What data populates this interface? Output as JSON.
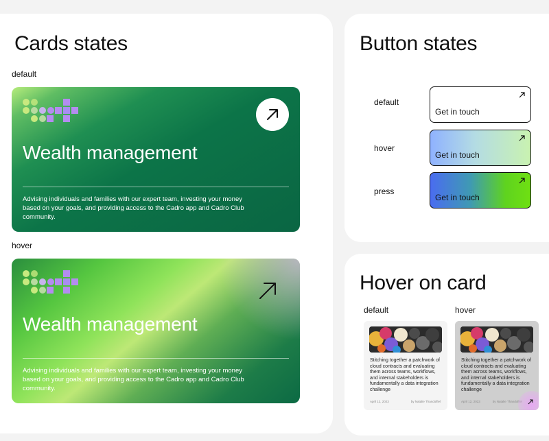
{
  "cards_panel": {
    "title": "Cards states",
    "default_label": "default",
    "hover_label": "hover",
    "card": {
      "title": "Wealth management",
      "description": "Advising individuals and families with our expert team, investing your money based on your goals, and providing access to the Cadro app and Cadro Club community."
    }
  },
  "button_panel": {
    "title": "Button states",
    "states": [
      {
        "label": "default",
        "button_text": "Get in touch"
      },
      {
        "label": "hover",
        "button_text": "Get in touch"
      },
      {
        "label": "press",
        "button_text": "Get in touch"
      }
    ]
  },
  "hover_panel": {
    "title": "Hover on card",
    "default_label": "default",
    "hover_label": "hover",
    "article": {
      "text": "Stitching together a patchwork of cloud contracts and evaluating them across teams, workflows, and internal stakeholders is fundamentally a data integration challenge",
      "date": "April 12, 2023",
      "author": "by Natalie Thandolfiel"
    }
  },
  "icons": {
    "arrow": "arrow-up-right-icon",
    "logo": "pixel-dots-logo"
  },
  "colors": {
    "card_dark_green": "#0b6b45",
    "card_light_green": "#b7ec7c",
    "button_press_blue": "#4a6cf0",
    "button_press_green": "#6fe012",
    "logo_lime": "#c8e97f",
    "logo_purple": "#b48cf0"
  }
}
